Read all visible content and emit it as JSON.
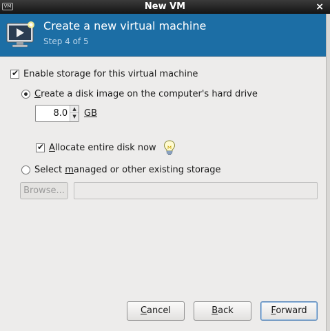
{
  "window": {
    "title": "New VM",
    "menu_icon_glyph": "VM",
    "close_glyph": "×"
  },
  "header": {
    "title": "Create a new virtual machine",
    "step": "Step 4 of 5",
    "background_color": "#1c6ea5",
    "icon": "virtual-machine-monitor-icon"
  },
  "storage": {
    "enable_label": "Enable storage for this virtual machine",
    "enable_checked": true,
    "create_option": {
      "label_mnemonic": "C",
      "label_rest": "reate a disk image on the computer's hard drive",
      "selected": true
    },
    "size": {
      "value": "8.0",
      "unit": "GB"
    },
    "allocate": {
      "label_mnemonic": "A",
      "label_rest": "llocate entire disk now",
      "checked": true,
      "hint_icon": "lightbulb-icon"
    },
    "managed_option": {
      "label_before": "Select ",
      "label_mnemonic": "m",
      "label_after": "anaged or other existing storage",
      "selected": false
    },
    "browse_label": "Browse...",
    "path_value": ""
  },
  "buttons": {
    "cancel_mnemonic": "C",
    "cancel_rest": "ancel",
    "back_mnemonic": "B",
    "back_rest": "ack",
    "forward_mnemonic": "F",
    "forward_rest": "orward"
  }
}
